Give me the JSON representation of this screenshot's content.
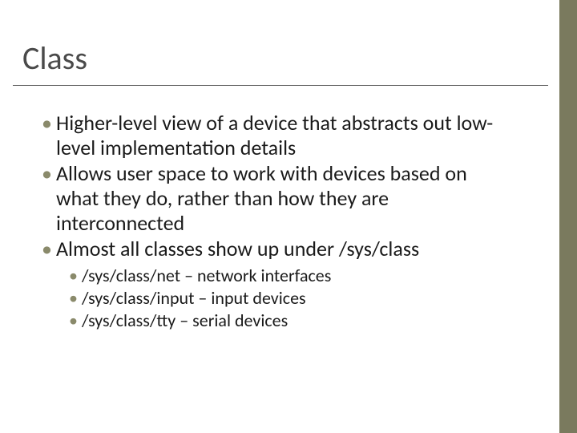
{
  "title": "Class",
  "bullets": {
    "b1": "Higher-level view of a device that abstracts out low-level implementation details",
    "b2": "Allows user space to work with devices based on what they do, rather than how they are interconnected",
    "b3": "Almost all classes show up under /sys/class",
    "sub": {
      "s1": "/sys/class/net – network interfaces",
      "s2": "/sys/class/input – input devices",
      "s3": "/sys/class/tty – serial devices"
    }
  }
}
